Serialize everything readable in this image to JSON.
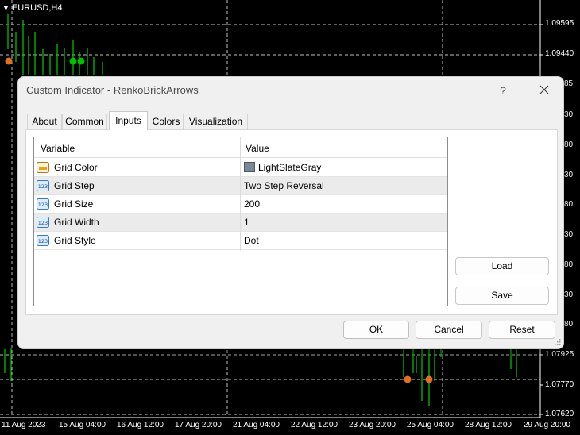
{
  "chart": {
    "symbol_title": "EURUSD,H4",
    "price_labels": [
      "1.09595",
      "1.09440",
      "1.07925",
      "1.07770",
      "1.07620"
    ],
    "partial_price_labels": [
      "85",
      "30",
      "80",
      "30",
      "80",
      "30",
      "80",
      "30",
      "80"
    ],
    "time_labels": [
      "11 Aug 2023",
      "15 Aug 04:00",
      "16 Aug 12:00",
      "17 Aug 20:00",
      "21 Aug 04:00",
      "22 Aug 12:00",
      "23 Aug 20:00",
      "25 Aug 04:00",
      "28 Aug 12:00",
      "29 Aug 20:00"
    ],
    "colors": {
      "background": "#000000",
      "bull": "#00c000",
      "arrow": "#e07020",
      "grid": "#c0c0c0"
    }
  },
  "dialog": {
    "title": "Custom Indicator - RenkoBrickArrows",
    "help_label": "?",
    "tabs": [
      {
        "label": "About"
      },
      {
        "label": "Common"
      },
      {
        "label": "Inputs",
        "active": true
      },
      {
        "label": "Colors"
      },
      {
        "label": "Visualization"
      }
    ],
    "grid": {
      "headers": {
        "variable": "Variable",
        "value": "Value"
      },
      "rows": [
        {
          "name": "Grid Color",
          "value": "LightSlateGray",
          "icon": "color-icon",
          "swatch_color": "#778899"
        },
        {
          "name": "Grid Step",
          "value": "Two Step Reversal",
          "icon": "number-icon"
        },
        {
          "name": "Grid Size",
          "value": "200",
          "icon": "number-icon"
        },
        {
          "name": "Grid Width",
          "value": "1",
          "icon": "number-icon"
        },
        {
          "name": "Grid Style",
          "value": "Dot",
          "icon": "number-icon"
        }
      ]
    },
    "buttons": {
      "load": "Load",
      "save": "Save",
      "ok": "OK",
      "cancel": "Cancel",
      "reset": "Reset"
    }
  }
}
